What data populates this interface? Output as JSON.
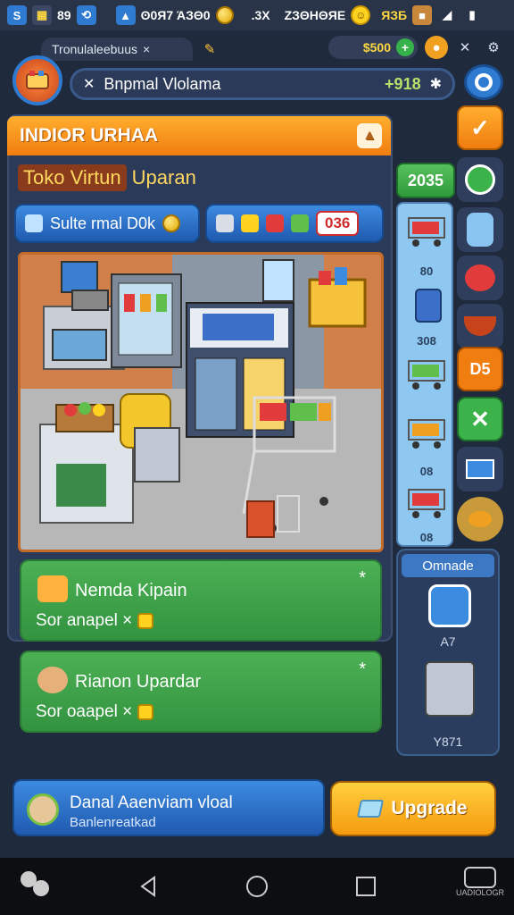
{
  "status_bar": {
    "counter_a": "89",
    "counter_b": "ʘ0Я7 ΆЗΘ0",
    "counter_c": ".3X",
    "counter_d": "ΖЗΘΗΘЯΕ",
    "counter_e": "ЯЗБ"
  },
  "header": {
    "tab_label": "Tronulaleebuus",
    "tab_close": "×",
    "coins": "$500",
    "search_text": "Bnpmal Vlolama",
    "search_value": "+918"
  },
  "panel": {
    "title": "INDIOR URHAA",
    "shop_name": "Toko Virtun",
    "shop_sub": "Uparan",
    "left_pill_label": "Sulte rmal D0k",
    "right_pill_badge": "036"
  },
  "right_column": {
    "top_chip": "2035",
    "cart_labels": [
      "80",
      "308",
      "08",
      "08",
      "08"
    ]
  },
  "cards": [
    {
      "title": "Nemda Kipain",
      "subtitle": "Sor anapel ×",
      "star": "*"
    },
    {
      "title": "Rianon Upardar",
      "subtitle": "Sor oaapel ×",
      "star": "*"
    }
  ],
  "upgrade_panel": {
    "header": "Omnade",
    "label_1": "A7",
    "label_2": "Y871"
  },
  "bottom": {
    "card_title": "Danal Aaenviam vloal",
    "card_sub": "Banlenreatkad",
    "upgrade_label": "Upgrade",
    "nav_right_text": "UADIOLOGR"
  },
  "colors": {
    "accent_orange": "#f07d10",
    "accent_green": "#339340",
    "accent_blue": "#1f5ab0",
    "background": "#1f2a3d"
  }
}
